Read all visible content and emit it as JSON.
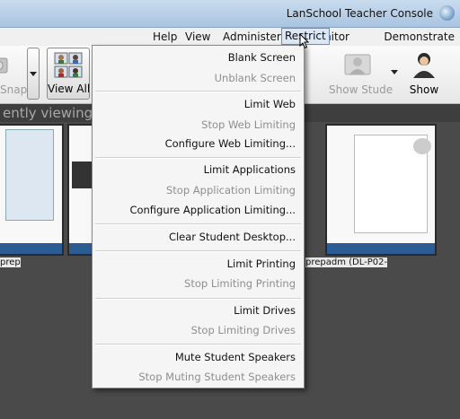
{
  "window": {
    "title": "LanSchool Teacher Console"
  },
  "menubar": {
    "items": [
      "Demonstrate",
      "Monitor",
      "Restrict",
      "Administer",
      "View",
      "Help"
    ],
    "active": "Restrict"
  },
  "toolbar": {
    "show_label": "Show",
    "show_student_label": "Show Stude",
    "view_all_label": "View All",
    "snapshot_label": "Snap"
  },
  "status": {
    "text": "ently viewing all"
  },
  "thumbnails": [
    {
      "label": "prepadm (DL-P02-"
    },
    {
      "label": "prep"
    }
  ],
  "restrict_menu": {
    "groups": [
      [
        {
          "label": "Blank Screen",
          "enabled": true
        },
        {
          "label": "Unblank Screen",
          "enabled": false
        }
      ],
      [
        {
          "label": "Limit Web",
          "enabled": true
        },
        {
          "label": "Stop Web Limiting",
          "enabled": false
        },
        {
          "label": "Configure Web Limiting...",
          "enabled": true
        }
      ],
      [
        {
          "label": "Limit Applications",
          "enabled": true
        },
        {
          "label": "Stop Application Limiting",
          "enabled": false
        },
        {
          "label": "Configure Application Limiting...",
          "enabled": true
        }
      ],
      [
        {
          "label": "Clear Student Desktop...",
          "enabled": true
        }
      ],
      [
        {
          "label": "Limit Printing",
          "enabled": true
        },
        {
          "label": "Stop Limiting Printing",
          "enabled": false
        }
      ],
      [
        {
          "label": "Limit Drives",
          "enabled": true
        },
        {
          "label": "Stop Limiting Drives",
          "enabled": false
        }
      ],
      [
        {
          "label": "Mute Student Speakers",
          "enabled": true
        },
        {
          "label": "Stop Muting Student Speakers",
          "enabled": false
        }
      ]
    ]
  }
}
